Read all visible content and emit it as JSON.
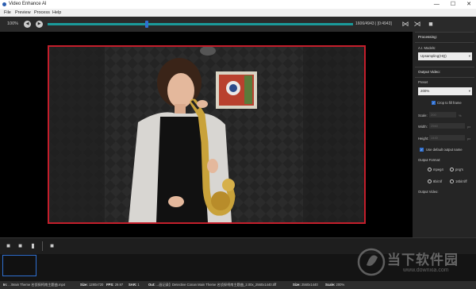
{
  "window": {
    "title": "Video Enhance AI",
    "controls": [
      "—",
      "☐",
      "✕"
    ]
  },
  "menu": [
    "File",
    "Preview",
    "Process",
    "Help"
  ],
  "controls": {
    "zoom": "100%",
    "frame_counter": "1606/4943 | [0:4943]"
  },
  "sidebar": {
    "processing_title": "Processing:",
    "ai_models_label": "A.I. Models:",
    "ai_model_value": "Upsampling(HQ)",
    "output_title": "Output Video:",
    "preset_label": "Preset",
    "preset_value": "200%",
    "crop_label": "Crop to fill frame",
    "scale_label": "Scale:",
    "scale_value": "200",
    "scale_unit": "%",
    "width_label": "Width:",
    "width_value": "2560",
    "width_unit": "px",
    "height_label": "Height:",
    "height_value": "1440",
    "height_unit": "px",
    "default_name_label": "Use default output name",
    "format_title": "Output Format:",
    "formats": [
      "mpeg4",
      "png's",
      "8bit tif",
      "16bit tiff"
    ],
    "format_selected": "16bit tiff",
    "output_video_label": "Output Video:"
  },
  "status": {
    "in_label": "In:",
    "in_file": "...\\Main Theme 名侦探柯南主题曲.mp4",
    "size_label": "Size:",
    "size": "1280x720",
    "fps_label": "FPS:",
    "fps": "29.97",
    "sar_label": "SAR:",
    "sar": "1",
    "out_label": "Out:",
    "out_file": "...画记录】Detective Conan Main Theme 名侦探柯南主题曲_2.00x_2560x1440.tiff",
    "out_size_label": "Size:",
    "out_size": "2560x1440",
    "scale_label": "Scale:",
    "scale": "200%"
  },
  "watermark": {
    "text": "当下软件园",
    "url": "www.downxia.com"
  }
}
